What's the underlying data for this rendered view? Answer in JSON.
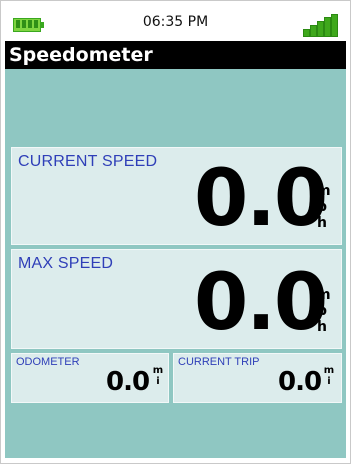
{
  "status": {
    "time": "06:35 PM",
    "battery_icon": "battery-icon",
    "signal_icon": "signal-bars-icon",
    "accent_green": "#3fa81c"
  },
  "app": {
    "title": "Speedometer"
  },
  "current_speed": {
    "label": "CURRENT SPEED",
    "value": "0.0",
    "unit": [
      "m",
      "p",
      "h"
    ]
  },
  "max_speed": {
    "label": "MAX SPEED",
    "value": "0.0",
    "unit": [
      "m",
      "p",
      "h"
    ]
  },
  "odometer": {
    "label": "ODOMETER",
    "value": "0.0",
    "unit": [
      "m",
      "i"
    ]
  },
  "current_trip": {
    "label": "CURRENT TRIP",
    "value": "0.0",
    "unit": [
      "m",
      "i"
    ]
  },
  "colors": {
    "background": "#8fc7c2",
    "panel": "#dcecec",
    "label": "#2f3fb8",
    "titlebar": "#000000"
  }
}
